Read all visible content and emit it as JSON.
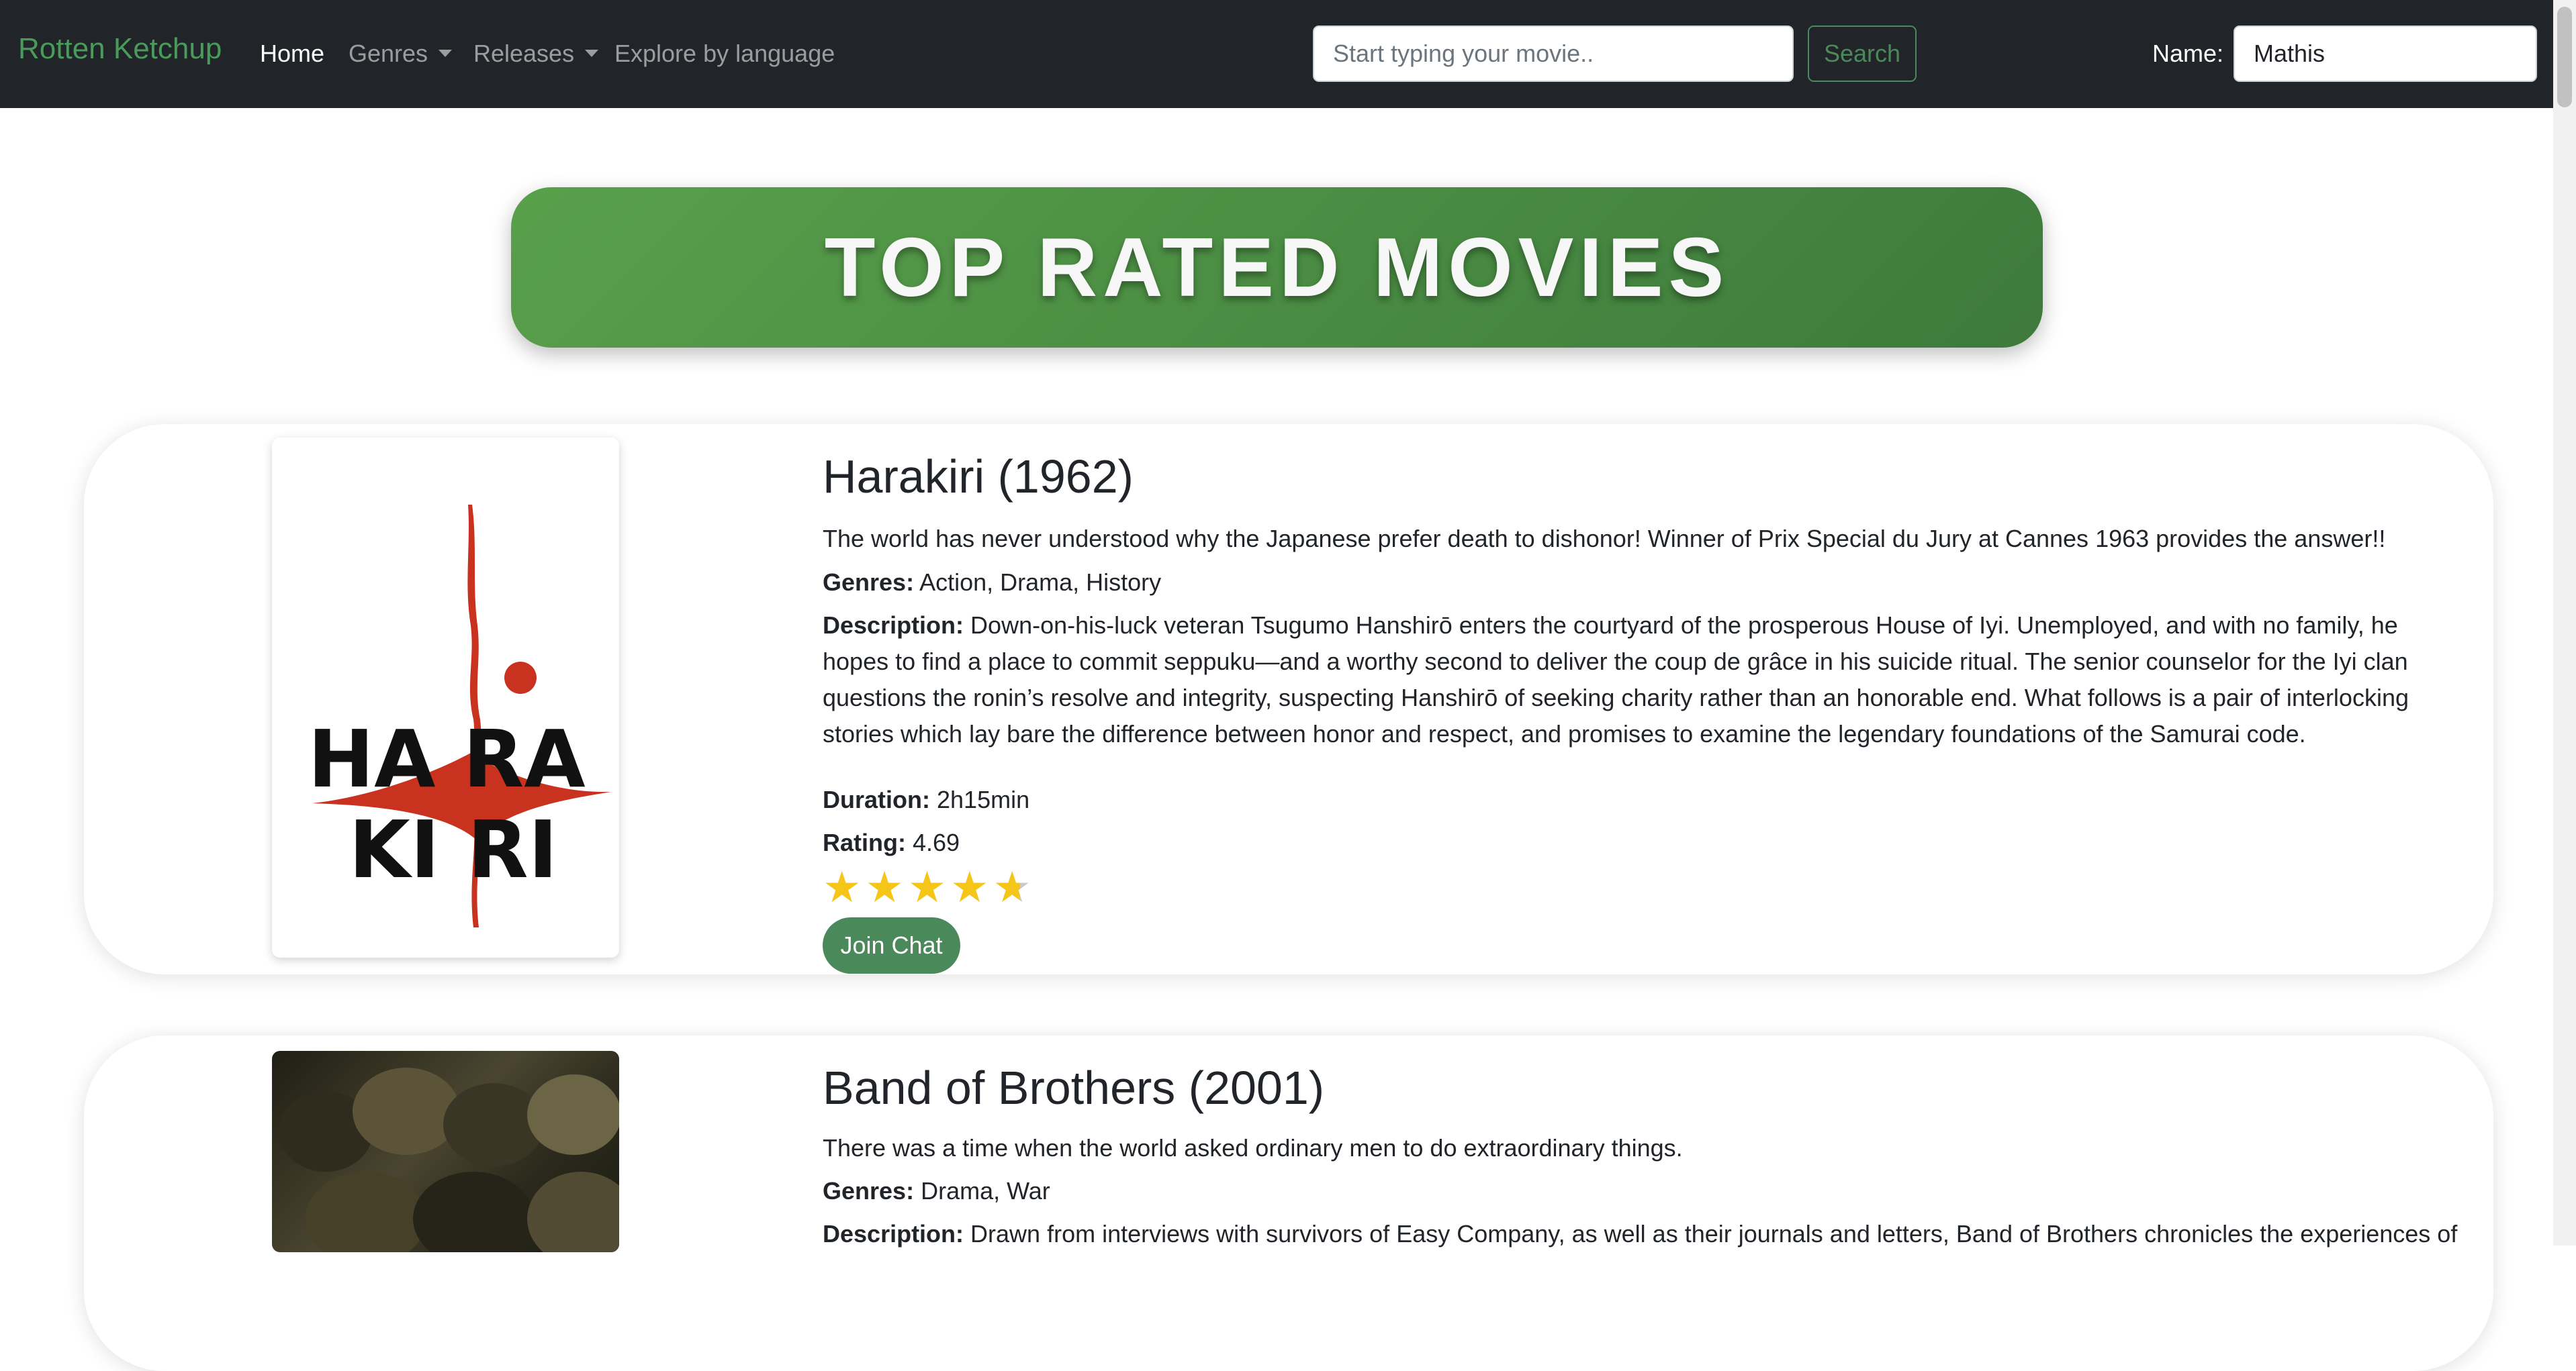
{
  "navbar": {
    "brand": "Rotten Ketchup",
    "links": [
      {
        "label": "Home",
        "active": true
      },
      {
        "label": "Genres",
        "dropdown": true
      },
      {
        "label": "Releases",
        "dropdown": true
      },
      {
        "label": "Explore by language"
      }
    ],
    "search": {
      "placeholder": "Start typing your movie..",
      "value": "",
      "button_label": "Search"
    },
    "name": {
      "label": "Name:",
      "value": "Mathis"
    }
  },
  "banner": {
    "title": "TOP RATED MOVIES"
  },
  "labels": {
    "genres": "Genres:",
    "description": "Description:",
    "duration": "Duration:",
    "rating": "Rating:"
  },
  "movies": [
    {
      "title": "Harakiri (1962)",
      "tagline": "The world has never understood why the Japanese prefer death to dishonor! Winner of Prix Special du Jury at Cannes 1963 provides the answer!!",
      "genres": "Action, Drama, History",
      "description": "Down-on-his-luck veteran Tsugumo Hanshirō enters the courtyard of the prosperous House of Iyi. Unemployed, and with no family, he hopes to find a place to commit seppuku—and a worthy second to deliver the coup de grâce in his suicide ritual. The senior counselor for the Iyi clan questions the ronin’s resolve and integrity, suspecting Hanshirō of seeking charity rather than an honorable end. What follows is a pair of interlocking stories which lay bare the difference between honor and respect, and promises to examine the legendary foundations of the Samurai code.",
      "duration": "2h15min",
      "rating": "4.69",
      "rating_stars": 4.69,
      "poster_text_top": "HA  RA",
      "poster_text_bottom": "KI RI",
      "chat_label": "Join Chat"
    },
    {
      "title": "Band of Brothers (2001)",
      "tagline": "There was a time when the world asked ordinary men to do extraordinary things.",
      "genres": "Drama, War",
      "description": "Drawn from interviews with survivors of Easy Company, as well as their journals and letters, Band of Brothers chronicles the experiences of"
    }
  ],
  "colors": {
    "navbar_bg": "#212529",
    "brand": "#4a9a5b",
    "accent": "#4a8a5a",
    "banner_start": "#59a04b",
    "banner_end": "#3d7a3c",
    "star": "#f5c518"
  }
}
